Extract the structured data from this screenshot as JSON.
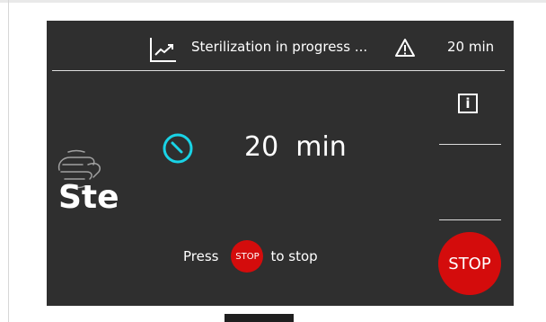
{
  "header": {
    "status_icon": "trend-chart-icon",
    "status_text": "Sterilization in progress ...",
    "warning_icon": "warning-triangle-icon",
    "time_text": "20 min"
  },
  "side": {
    "info_label": "i",
    "stop_label": "STOP"
  },
  "main": {
    "timer_icon": "clock-icon",
    "timer_value": "20  min",
    "partial_label": "Ste",
    "partial_icon": "hand-icon",
    "press_label": "Press",
    "stop_mini_label": "STOP",
    "to_stop_label": "to stop"
  },
  "colors": {
    "screen_bg": "#2f2f2f",
    "accent_cyan": "#19d3e6",
    "stop_red": "#d40c0c",
    "text": "#ffffff"
  }
}
